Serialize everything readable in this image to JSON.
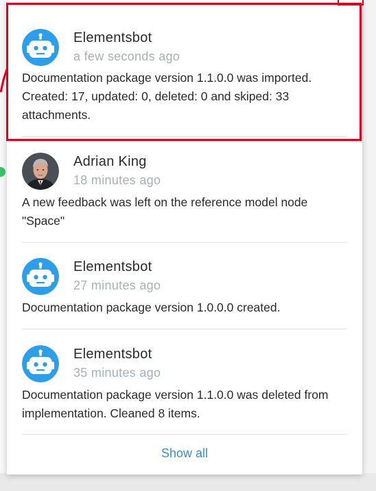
{
  "colors": {
    "highlight": "#e3001b",
    "status_dot": "#35c46a",
    "author_text": "#2b2b2b",
    "time_text": "#a8b0b8",
    "message_text": "#2b2b2b",
    "link": "#3a8fd1",
    "bot_avatar_bg": "#2d9ee9"
  },
  "notifications": [
    {
      "author": "Elementsbot",
      "time": "a few seconds ago",
      "message": "Documentation package version 1.1.0.0 was imported. Created: 17, updated: 0, deleted: 0 and skiped: 33 attachments.",
      "avatar": "robot-icon"
    },
    {
      "author": "Adrian King",
      "time": "18 minutes ago",
      "message": "A new feedback was left on the reference model node \"Space\"",
      "avatar": "user-photo"
    },
    {
      "author": "Elementsbot",
      "time": "27 minutes ago",
      "message": "Documentation package version 1.0.0.0 created.",
      "avatar": "robot-icon"
    },
    {
      "author": "Elementsbot",
      "time": "35 minutes ago",
      "message": "Documentation package version 1.1.0.0 was deleted from implementation. Cleaned 8 items.",
      "avatar": "robot-icon"
    }
  ],
  "footer": {
    "show_all_label": "Show all"
  }
}
